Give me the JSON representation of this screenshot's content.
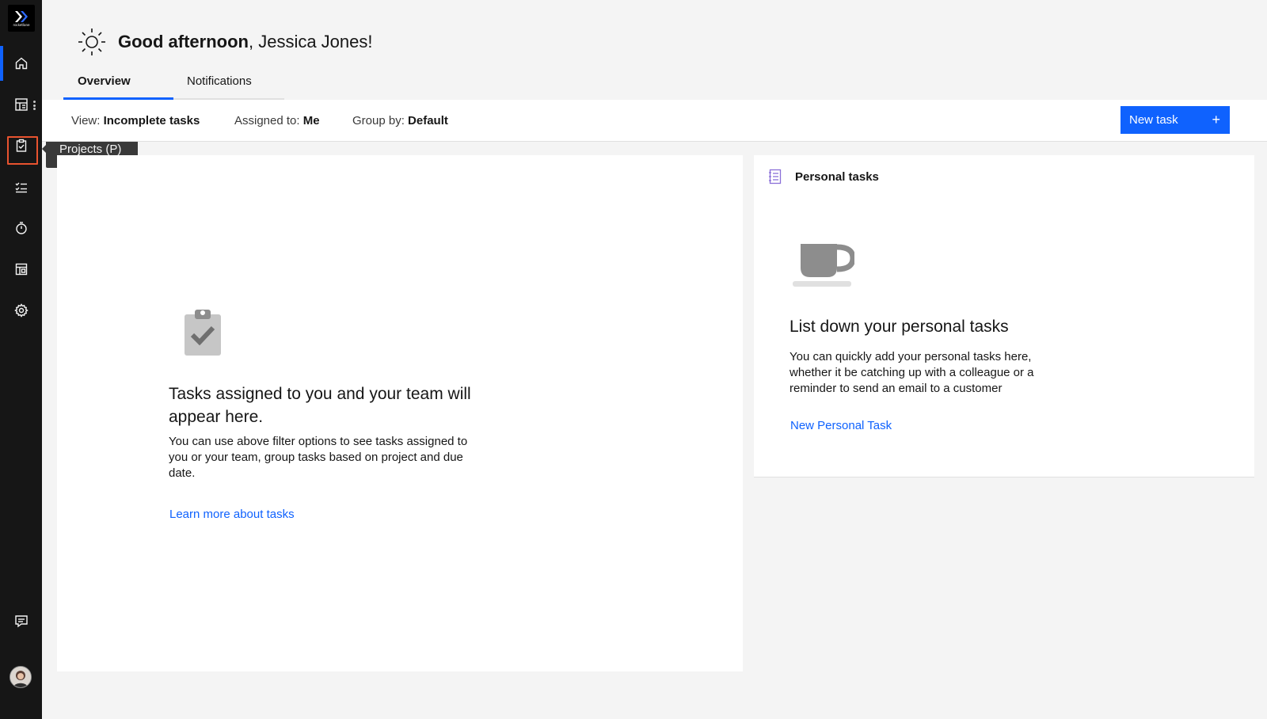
{
  "app": {
    "logo_text": "rocketlane"
  },
  "sidebar": {
    "items": [
      {
        "name": "home",
        "icon": "home-icon",
        "active": true
      },
      {
        "name": "dashboards",
        "icon": "dashboard-icon"
      },
      {
        "name": "projects",
        "icon": "clipboard-icon"
      },
      {
        "name": "tasks",
        "icon": "checklist-icon"
      },
      {
        "name": "timesheets",
        "icon": "timer-icon"
      },
      {
        "name": "templates",
        "icon": "templates-icon"
      },
      {
        "name": "settings",
        "icon": "gear-icon"
      },
      {
        "name": "feedback",
        "icon": "chat-icon"
      }
    ],
    "tooltip": "Projects (P)"
  },
  "header": {
    "greeting_bold": "Good afternoon",
    "greeting_rest": ", Jessica Jones!",
    "tabs": [
      {
        "label": "Overview",
        "selected": true
      },
      {
        "label": "Notifications",
        "selected": false
      }
    ]
  },
  "filters": {
    "view_label": "View:",
    "view_value": "Incomplete tasks",
    "assigned_label": "Assigned to:",
    "assigned_value": "Me",
    "group_label": "Group by:",
    "group_value": "Default",
    "new_task_label": "New task",
    "new_task_icon": "+"
  },
  "tasks_empty": {
    "title": "Tasks assigned to you and your team will appear here.",
    "description": "You can use above filter options to see tasks assigned to you or your team, group tasks based on project and due date.",
    "link": "Learn more about tasks"
  },
  "personal_tasks": {
    "heading": "Personal tasks",
    "title": "List down your personal tasks",
    "description": "You can quickly add your personal tasks here, whether it be catching up with a colleague or a reminder to send an email to a customer",
    "link": "New Personal Task"
  },
  "colors": {
    "sidebar": "#161616",
    "accent": "#0f62fe",
    "highlight": "#e8532f"
  }
}
